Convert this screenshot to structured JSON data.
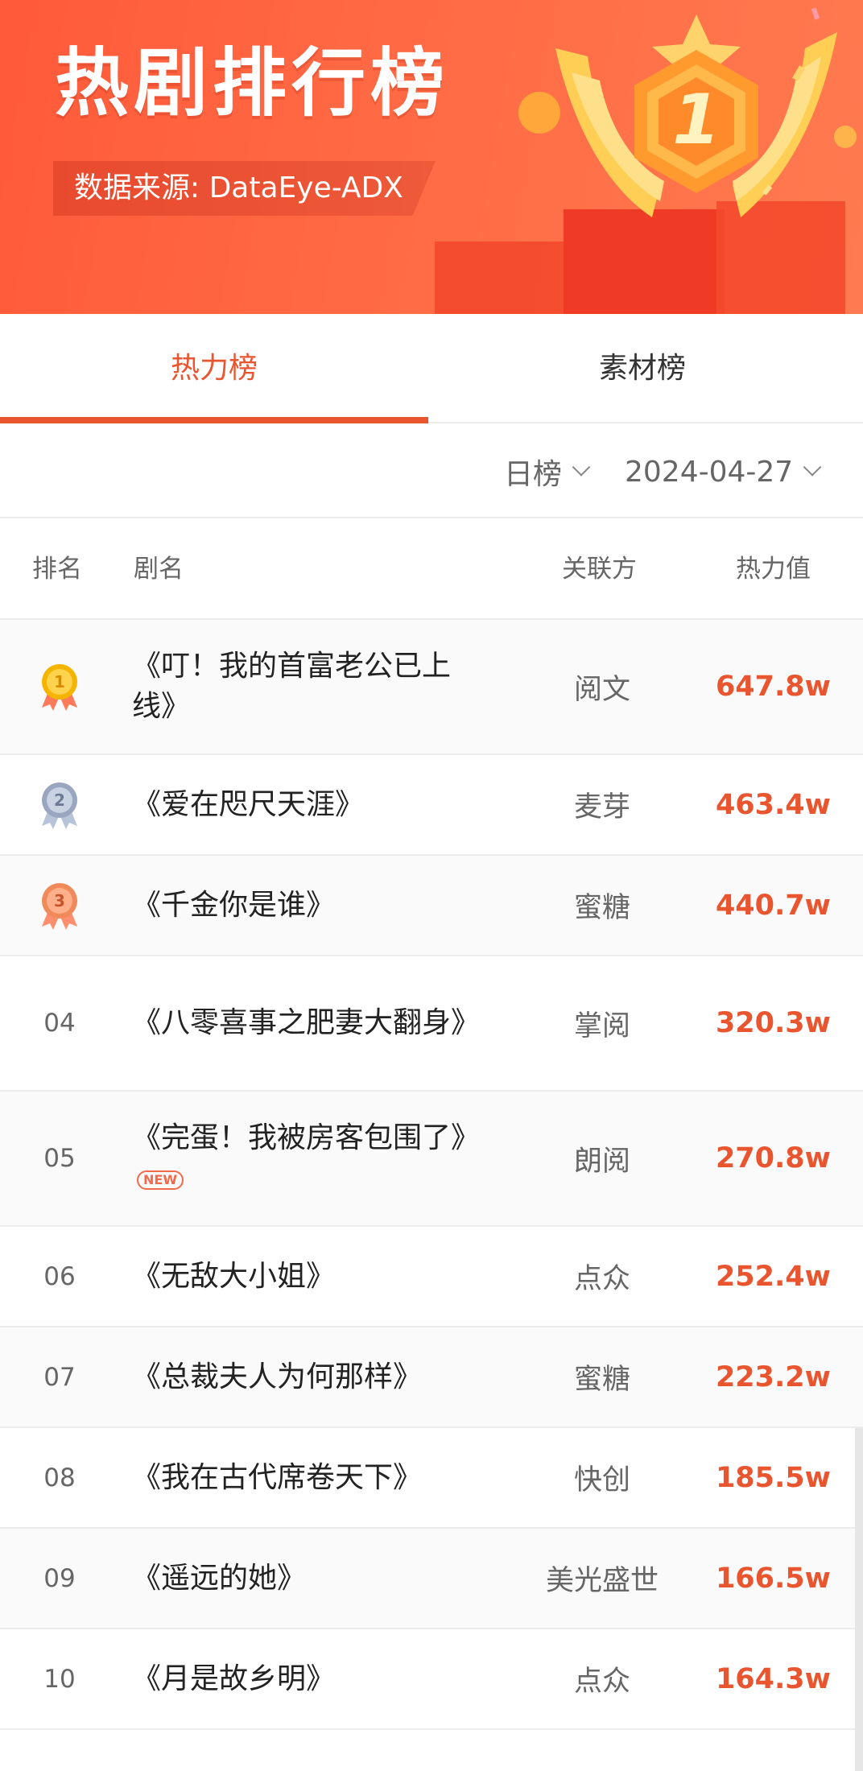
{
  "banner": {
    "title": "热剧排行榜",
    "source": "数据来源: DataEye-ADX",
    "trophy_icon": "trophy-rank-1-icon",
    "trophy_number": "1"
  },
  "tabs": [
    {
      "label": "热力榜",
      "active": true
    },
    {
      "label": "素材榜",
      "active": false
    }
  ],
  "filters": {
    "period": "日榜",
    "date": "2024-04-27"
  },
  "table": {
    "headers": {
      "rank": "排名",
      "name": "剧名",
      "partner": "关联方",
      "heat": "热力值"
    },
    "rows": [
      {
        "rank": "01",
        "medal": "gold",
        "medal_number": "1",
        "name": "《叮！我的首富老公已上线》",
        "partner": "阅文",
        "heat": "647.8w",
        "is_new": false
      },
      {
        "rank": "02",
        "medal": "silver",
        "medal_number": "2",
        "name": "《爱在咫尺天涯》",
        "partner": "麦芽",
        "heat": "463.4w",
        "is_new": false
      },
      {
        "rank": "03",
        "medal": "bronze",
        "medal_number": "3",
        "name": "《千金你是谁》",
        "partner": "蜜糖",
        "heat": "440.7w",
        "is_new": false
      },
      {
        "rank": "04",
        "medal": null,
        "name": "《八零喜事之肥妻大翻身》",
        "partner": "掌阅",
        "heat": "320.3w",
        "is_new": false
      },
      {
        "rank": "05",
        "medal": null,
        "name": "《完蛋！我被房客包围了》",
        "partner": "朗阅",
        "heat": "270.8w",
        "is_new": true,
        "new_label": "NEW"
      },
      {
        "rank": "06",
        "medal": null,
        "name": "《无敌大小姐》",
        "partner": "点众",
        "heat": "252.4w",
        "is_new": false
      },
      {
        "rank": "07",
        "medal": null,
        "name": "《总裁夫人为何那样》",
        "partner": "蜜糖",
        "heat": "223.2w",
        "is_new": false
      },
      {
        "rank": "08",
        "medal": null,
        "name": "《我在古代席卷天下》",
        "partner": "快创",
        "heat": "185.5w",
        "is_new": false
      },
      {
        "rank": "09",
        "medal": null,
        "name": "《遥远的她》",
        "partner": "美光盛世",
        "heat": "166.5w",
        "is_new": false
      },
      {
        "rank": "10",
        "medal": null,
        "name": "《月是故乡明》",
        "partner": "点众",
        "heat": "164.3w",
        "is_new": false
      }
    ]
  },
  "colors": {
    "accent": "#e8552f",
    "banner": "#ff5a3a",
    "gold": "#f5b400",
    "silver": "#9aa6c0",
    "bronze": "#f08a5a"
  }
}
